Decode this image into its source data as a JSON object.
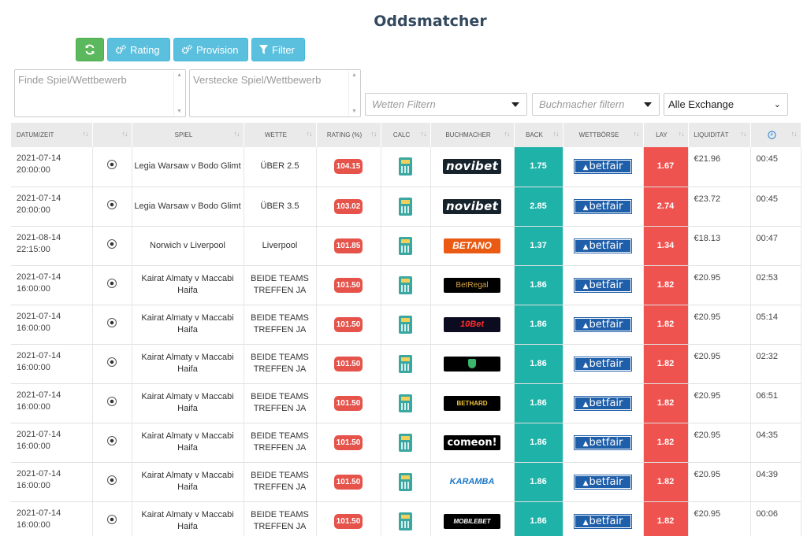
{
  "title": "Oddsmatcher",
  "toolbar": {
    "refresh_icon": "refresh-icon",
    "rating_label": "Rating",
    "provision_label": "Provision",
    "filter_label": "Filter"
  },
  "filters": {
    "find_placeholder": "Finde Spiel/Wettbewerb",
    "hide_placeholder": "Verstecke Spiel/Wettbewerb",
    "bets_placeholder": "Wetten Filtern",
    "bookmaker_placeholder": "Buchmacher filtern",
    "exchange_selected": "Alle Exchange"
  },
  "columns": [
    "Datum/Zeit",
    "",
    "Spiel",
    "Wette",
    "Rating (%)",
    "Calc",
    "Buchmacher",
    "Back",
    "Wettbörse",
    "Lay",
    "Liquidität",
    ""
  ],
  "colors": {
    "back": "#1fb2a8",
    "lay": "#ef5350",
    "rating": "#e5534b",
    "betfair": "#1f5ea8"
  },
  "rows": [
    {
      "date": "2021-07-14",
      "time": "20:00:00",
      "match": "Legia Warsaw v Bodo Glimt",
      "bet": "ÜBER 2.5",
      "rating": "104.15",
      "bookmaker": "novibet",
      "back": "1.75",
      "exchange": "betfair",
      "lay": "1.67",
      "liquidity": "€21.96",
      "remaining": "00:45"
    },
    {
      "date": "2021-07-14",
      "time": "20:00:00",
      "match": "Legia Warsaw v Bodo Glimt",
      "bet": "ÜBER 3.5",
      "rating": "103.02",
      "bookmaker": "novibet",
      "back": "2.85",
      "exchange": "betfair",
      "lay": "2.74",
      "liquidity": "€23.72",
      "remaining": "00:45"
    },
    {
      "date": "2021-08-14",
      "time": "22:15:00",
      "match": "Norwich v Liverpool",
      "bet": "Liverpool",
      "rating": "101.85",
      "bookmaker": "BETANO",
      "back": "1.37",
      "exchange": "betfair",
      "lay": "1.34",
      "liquidity": "€18.13",
      "remaining": "00:47"
    },
    {
      "date": "2021-07-14",
      "time": "16:00:00",
      "match": "Kairat Almaty v Maccabi Haifa",
      "bet": "BEIDE TEAMS TREFFEN JA",
      "rating": "101.50",
      "bookmaker": "BetRegal",
      "back": "1.86",
      "exchange": "betfair",
      "lay": "1.82",
      "liquidity": "€20.95",
      "remaining": "02:53"
    },
    {
      "date": "2021-07-14",
      "time": "16:00:00",
      "match": "Kairat Almaty v Maccabi Haifa",
      "bet": "BEIDE TEAMS TREFFEN JA",
      "rating": "101.50",
      "bookmaker": "10Bet",
      "back": "1.86",
      "exchange": "betfair",
      "lay": "1.82",
      "liquidity": "€20.95",
      "remaining": "05:14"
    },
    {
      "date": "2021-07-14",
      "time": "16:00:00",
      "match": "Kairat Almaty v Maccabi Haifa",
      "bet": "BEIDE TEAMS TREFFEN JA",
      "rating": "101.50",
      "bookmaker": "",
      "back": "1.86",
      "exchange": "betfair",
      "lay": "1.82",
      "liquidity": "€20.95",
      "remaining": "02:32"
    },
    {
      "date": "2021-07-14",
      "time": "16:00:00",
      "match": "Kairat Almaty v Maccabi Haifa",
      "bet": "BEIDE TEAMS TREFFEN JA",
      "rating": "101.50",
      "bookmaker": "BETHARD",
      "back": "1.86",
      "exchange": "betfair",
      "lay": "1.82",
      "liquidity": "€20.95",
      "remaining": "06:51"
    },
    {
      "date": "2021-07-14",
      "time": "16:00:00",
      "match": "Kairat Almaty v Maccabi Haifa",
      "bet": "BEIDE TEAMS TREFFEN JA",
      "rating": "101.50",
      "bookmaker": "comeon!",
      "back": "1.86",
      "exchange": "betfair",
      "lay": "1.82",
      "liquidity": "€20.95",
      "remaining": "04:35"
    },
    {
      "date": "2021-07-14",
      "time": "16:00:00",
      "match": "Kairat Almaty v Maccabi Haifa",
      "bet": "BEIDE TEAMS TREFFEN JA",
      "rating": "101.50",
      "bookmaker": "KARAMBA",
      "back": "1.86",
      "exchange": "betfair",
      "lay": "1.82",
      "liquidity": "€20.95",
      "remaining": "04:39"
    },
    {
      "date": "2021-07-14",
      "time": "16:00:00",
      "match": "Kairat Almaty v Maccabi Haifa",
      "bet": "BEIDE TEAMS TREFFEN JA",
      "rating": "101.50",
      "bookmaker": "MOBILEBET",
      "back": "1.86",
      "exchange": "betfair",
      "lay": "1.82",
      "liquidity": "€20.95",
      "remaining": "00:06"
    }
  ]
}
